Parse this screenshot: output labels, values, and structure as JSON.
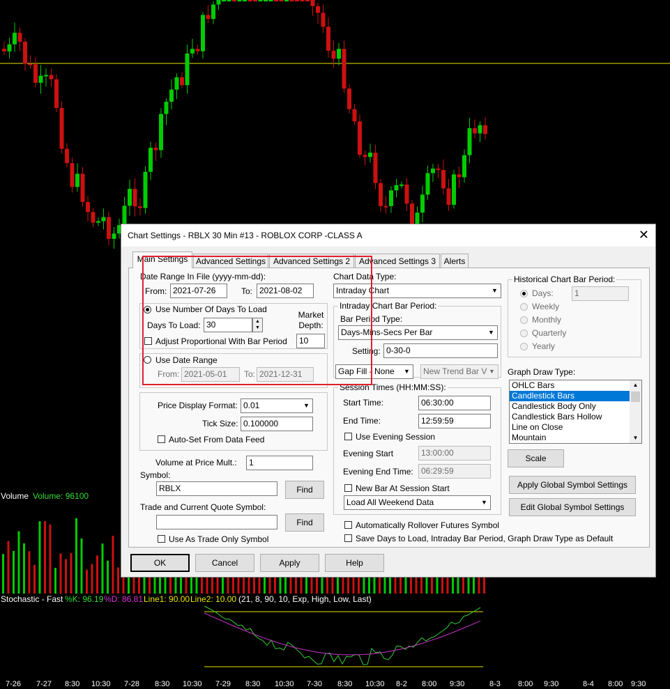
{
  "chart": {
    "volume_label": "Volume",
    "volume_value": "Volume: 96100",
    "stochastic": {
      "name": "Stochastic - Fast",
      "k": "%K: 96.19",
      "d": "%D: 86.81",
      "line1": "Line1: 90.00",
      "line2": "Line2: 10.00",
      "params": "(21, 8, 90, 10, Exp, High, Low, Last)"
    },
    "xaxis": [
      "7-26",
      "7-27",
      "8:30",
      "10:30",
      "7-28",
      "8:30",
      "10:30",
      "7-29",
      "8:30",
      "10:30",
      "7-30",
      "8:30",
      "10:30",
      "8-2",
      "8:00",
      "9:30",
      "8-3",
      "8:00",
      "9:30",
      "8-4",
      "8:00",
      "9:30"
    ],
    "colors": {
      "up": "#00cc00",
      "down": "#cc1111",
      "ref_line": "#e6e600",
      "k_line": "#33cc33",
      "d_line": "#cc33cc"
    }
  },
  "dialog": {
    "title": "Chart Settings - RBLX  30 Min   #13 - ROBLOX CORP -CLASS A",
    "close": "✕",
    "tabs": [
      "Main Settings",
      "Advanced Settings",
      "Advanced Settings 2",
      "Advanced Settings 3",
      "Alerts"
    ],
    "date_range_label": "Date Range In File (yyyy-mm-dd):",
    "from_label": "From:",
    "from_value": "2021-07-26",
    "to_label": "To:",
    "to_value": "2021-08-02",
    "use_days_label": "Use Number Of Days To Load",
    "days_to_load_label": "Days To Load:",
    "days_to_load_value": "30",
    "market_depth_label": "Market Depth:",
    "market_depth_value": "10",
    "adjust_label": "Adjust Proportional With Bar Period",
    "use_date_range_label": "Use Date Range",
    "dr_from_label": "From:",
    "dr_from_value": "2021-05-01",
    "dr_to_label": "To:",
    "dr_to_value": "2021-12-31",
    "price_format_label": "Price Display Format:",
    "price_format_value": "0.01",
    "tick_size_label": "Tick Size:",
    "tick_size_value": "0.100000",
    "autoset_label": "Auto-Set From Data Feed",
    "vol_mult_label": "Volume at Price Mult.:",
    "vol_mult_value": "1",
    "symbol_label": "Symbol:",
    "symbol_value": "RBLX",
    "find_label": "Find",
    "trade_symbol_label": "Trade and Current Quote Symbol:",
    "trade_symbol_value": "",
    "find2_label": "Find",
    "trade_only_label": "Use As Trade Only Symbol",
    "chart_data_type_label": "Chart Data Type:",
    "chart_data_type_value": "Intraday Chart",
    "intraday_period_label": "Intraday Chart Bar Period:",
    "bar_period_type_label": "Bar Period Type:",
    "bar_period_type_value": "Days-Mins-Secs Per Bar",
    "setting_label": "Setting:",
    "setting_value": "0-30-0",
    "gap_fill_value": "Gap Fill - None",
    "new_trend_value": "New Trend Bar V",
    "session_label": "Session Times (HH:MM:SS):",
    "start_time_label": "Start Time:",
    "start_time_value": "06:30:00",
    "end_time_label": "End Time:",
    "end_time_value": "12:59:59",
    "evening_session_label": "Use Evening Session",
    "evening_start_label": "Evening Start",
    "evening_start_value": "13:00:00",
    "evening_end_label": "Evening End Time:",
    "evening_end_value": "06:29:59",
    "new_bar_label": "New Bar At Session Start",
    "weekend_value": "Load All Weekend Data",
    "hist_period_label": "Historical Chart Bar Period:",
    "hist_options": [
      "Days:",
      "Weekly",
      "Monthly",
      "Quarterly",
      "Yearly"
    ],
    "hist_days_value": "1",
    "graph_draw_label": "Graph Draw Type:",
    "graph_draw_items": [
      "OHLC Bars",
      "Candlestick Bars",
      "Candlestick Body Only",
      "Candlestick Bars Hollow",
      "Line on Close",
      "Mountain"
    ],
    "graph_draw_selected": 1,
    "scale_label": "Scale",
    "apply_global_label": "Apply Global Symbol Settings",
    "edit_global_label": "Edit Global Symbol Settings",
    "auto_rollover_label": "Automatically Rollover Futures Symbol",
    "save_default_label": "Save Days to Load, Intraday Bar Period, Graph Draw Type as Default",
    "ok_label": "OK",
    "cancel_label": "Cancel",
    "apply_label": "Apply",
    "help_label": "Help"
  }
}
